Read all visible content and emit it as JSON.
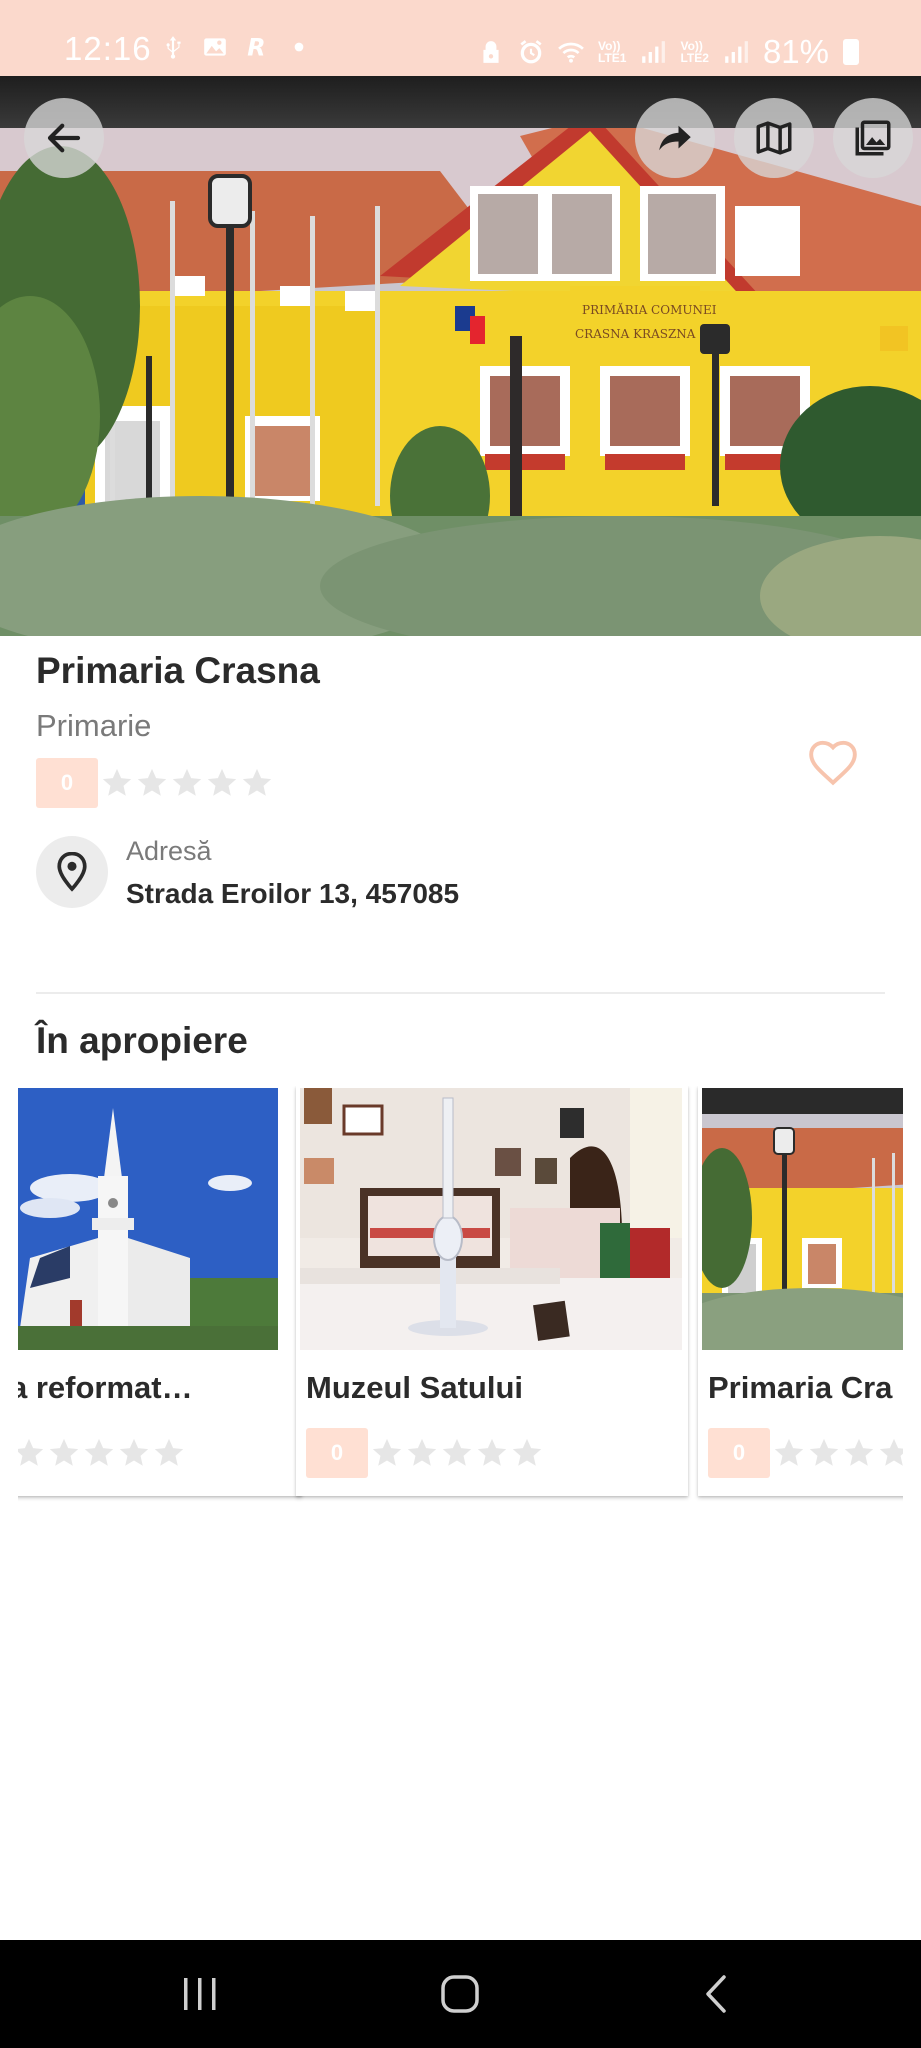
{
  "status_bar": {
    "time": "12:16",
    "battery_percent": "81%",
    "carrier_1": "Vo))\nLTE1",
    "carrier_2": "Vo))\nLTE2",
    "icons": [
      "usb-icon",
      "image-icon",
      "r-icon",
      "dot-icon",
      "lock-icon",
      "alarm-icon",
      "wifi-icon",
      "signal-icon",
      "battery-icon"
    ]
  },
  "hero": {
    "image_description": "yellow-town-hall-photo",
    "buttons": [
      "back-button",
      "share-button",
      "map-button",
      "gallery-button"
    ]
  },
  "place": {
    "title": "Primaria Crasna",
    "category": "Primarie",
    "rating_count": "0",
    "stars": 5,
    "favorite": false,
    "address_label": "Adresă",
    "address_value": "Strada Eroilor 13, 457085"
  },
  "nearby": {
    "title": "În apropiere",
    "items": [
      {
        "title": "a reformat…",
        "rating": "0"
      },
      {
        "title": "Muzeul Satului",
        "rating": "0"
      },
      {
        "title": "Primaria Cra",
        "rating": "0"
      }
    ]
  },
  "colors": {
    "accent": "#fbd9cc",
    "badge": "#ffe0d3",
    "star_empty": "#e6e6e6",
    "heart": "#f7c4ad"
  }
}
